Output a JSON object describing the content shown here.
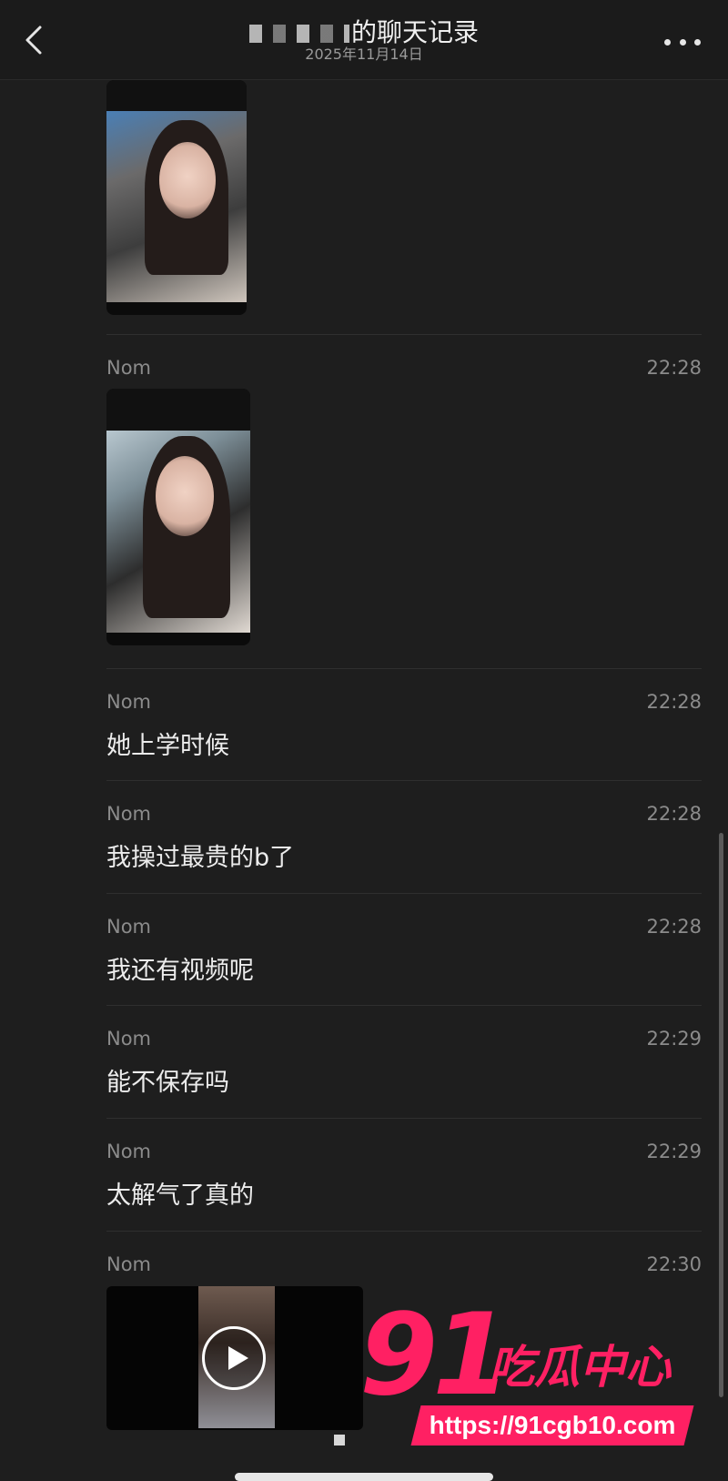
{
  "header": {
    "title_suffix": "的聊天记录",
    "subtitle": "2025年11月14日"
  },
  "messages": [
    {
      "sender": "Nom",
      "time": "22:28",
      "text": "",
      "kind": "image"
    },
    {
      "sender": "Nom",
      "time": "22:28",
      "text": "她上学时候",
      "kind": "text"
    },
    {
      "sender": "Nom",
      "time": "22:28",
      "text": "我操过最贵的b了",
      "kind": "text"
    },
    {
      "sender": "Nom",
      "time": "22:28",
      "text": "我还有视频呢",
      "kind": "text"
    },
    {
      "sender": "Nom",
      "time": "22:29",
      "text": "能不保存吗",
      "kind": "text"
    },
    {
      "sender": "Nom",
      "time": "22:29",
      "text": "太解气了真的",
      "kind": "text"
    },
    {
      "sender": "Nom",
      "time": "22:30",
      "text": "",
      "kind": "video"
    }
  ],
  "watermark": {
    "number": "91",
    "name": "吃瓜中心",
    "url": "https://91cgb10.com"
  },
  "colors": {
    "background": "#1e1e1e",
    "secondary_text": "#8b8b8b",
    "watermark": "#ff2063"
  },
  "icons": [
    "back-icon",
    "more-icon",
    "play-icon"
  ]
}
